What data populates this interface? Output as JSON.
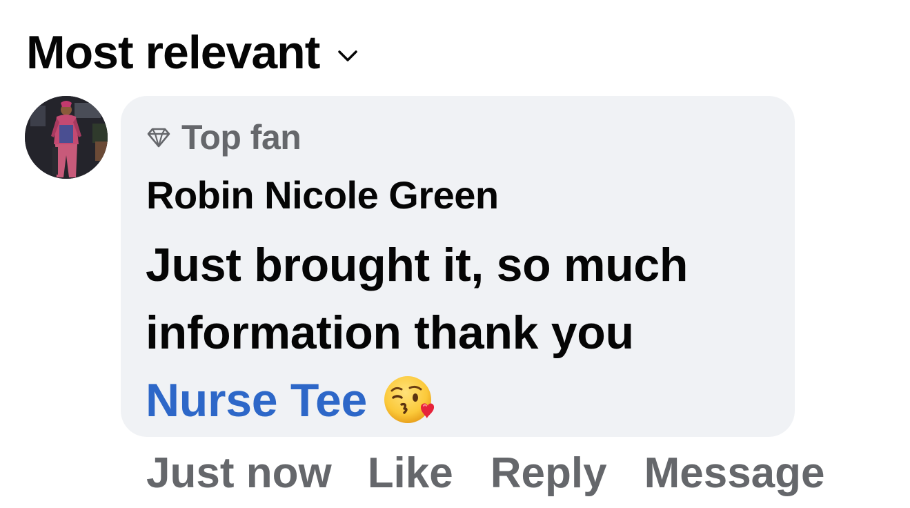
{
  "sort": {
    "label": "Most relevant",
    "chevron_icon": "chevron-down-icon"
  },
  "comment": {
    "avatar_icon": "profile-photo",
    "badge": {
      "icon": "diamond-icon",
      "label": "Top fan"
    },
    "author": "Robin Nicole Green",
    "text": "Just brought it, so much information thank you",
    "mention": "Nurse Tee",
    "emoji": "face-blowing-a-kiss-emoji",
    "bubble_color": "#f0f2f5",
    "mention_color": "#2d67c8"
  },
  "actions": {
    "time": "Just now",
    "like": "Like",
    "reply": "Reply",
    "message": "Message"
  }
}
